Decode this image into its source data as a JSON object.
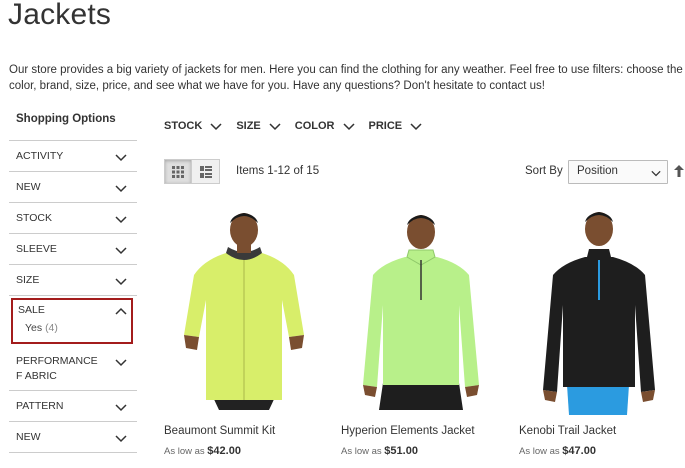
{
  "page": {
    "title": "Jackets"
  },
  "intro": "Our store provides a big variety of jackets for men. Here you can find the clothing for any weather. Feel free to use filters: choose the color, brand, size, price, and see what we have for you. Have any questions? Don't hesitate to contact us!",
  "sidebar": {
    "title": "Shopping Options",
    "filters": [
      {
        "label": "ACTIVITY"
      },
      {
        "label": "NEW"
      },
      {
        "label": "STOCK"
      },
      {
        "label": "SLEEVE"
      },
      {
        "label": "SIZE"
      },
      {
        "label": "SALE",
        "expanded": true,
        "option": "Yes",
        "count": "(4)"
      },
      {
        "label": "PERFORMANCE F ABRIC"
      },
      {
        "label": "PATTERN"
      },
      {
        "label": "NEW"
      }
    ]
  },
  "toolbar": {
    "filters": [
      "STOCK",
      "SIZE",
      "COLOR",
      "PRICE"
    ],
    "items_count": "Items 1-12 of 15",
    "sort_label": "Sort By",
    "sort_value": "Position"
  },
  "products": [
    {
      "name": "Beaumont Summit Kit",
      "price_prefix": "As low as",
      "price": "$42.00",
      "jacket_color": "#d8ee6a"
    },
    {
      "name": "Hyperion Elements Jacket",
      "price_prefix": "As low as",
      "price": "$51.00",
      "jacket_color": "#b8f08a"
    },
    {
      "name": "Kenobi Trail Jacket",
      "price_prefix": "As low as",
      "price": "$47.00",
      "jacket_color": "#1e1e1e"
    }
  ],
  "colors": {
    "active_filter_border": "#a31c1c"
  }
}
